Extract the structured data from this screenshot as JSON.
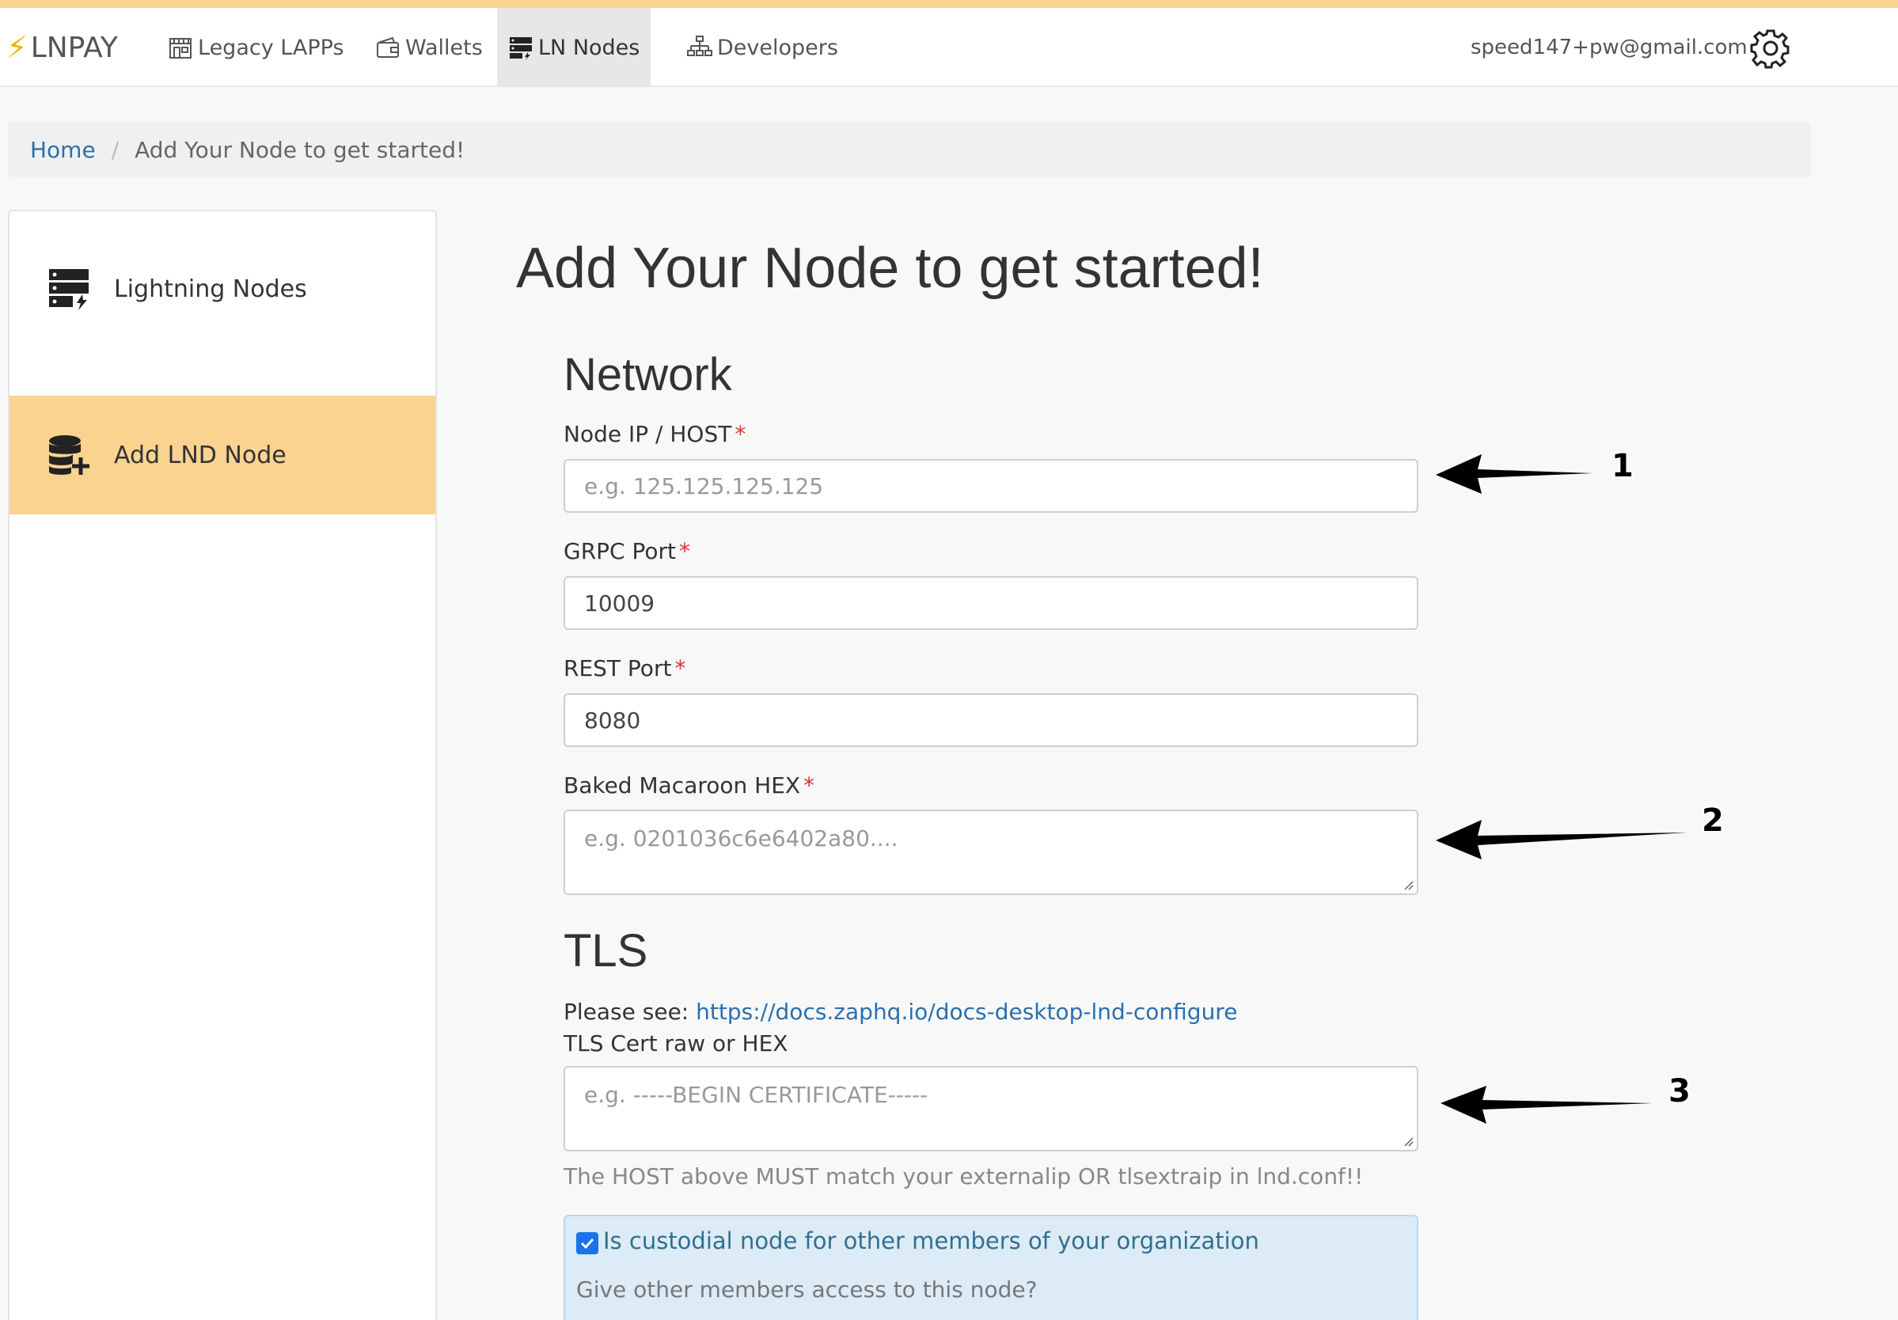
{
  "nav": {
    "brand": "LNPAY",
    "items": [
      {
        "label": "Legacy LAPPs",
        "icon": "store-icon"
      },
      {
        "label": "Wallets",
        "icon": "wallet-icon"
      },
      {
        "label": "LN Nodes",
        "icon": "server-icon"
      },
      {
        "label": "Developers",
        "icon": "sitemap-icon"
      }
    ],
    "active": "LN Nodes",
    "email": "speed147+pw@gmail.com"
  },
  "breadcrumb": {
    "home": "Home",
    "current": "Add Your Node to get started!"
  },
  "sidebar": {
    "items": [
      {
        "label": "Lightning Nodes",
        "icon": "lightning-server-icon"
      },
      {
        "label": "Add LND Node",
        "icon": "database-plus-icon"
      }
    ],
    "active": "Add LND Node"
  },
  "main": {
    "title": "Add Your Node to get started!",
    "network_heading": "Network",
    "host": {
      "label": "Node IP / HOST",
      "placeholder": "e.g. 125.125.125.125"
    },
    "grpc": {
      "label": "GRPC Port",
      "value": "10009"
    },
    "rest": {
      "label": "REST Port",
      "value": "8080"
    },
    "macaroon": {
      "label": "Baked Macaroon HEX",
      "placeholder": "e.g. 0201036c6e6402a80...."
    },
    "tls_heading": "TLS",
    "please_see": "Please see:",
    "docs_link": "https://docs.zaphq.io/docs-desktop-lnd-configure",
    "tls": {
      "label": "TLS Cert raw or HEX",
      "placeholder": "e.g. -----BEGIN CERTIFICATE-----"
    },
    "tls_note": "The HOST above MUST match your externalip OR tlsextraip in lnd.conf!!",
    "custodial": {
      "checked": true,
      "label": "Is custodial node for other members of your organization",
      "sub": "Give other members access to this node?"
    },
    "required_marker": "*"
  },
  "annotations": [
    "1",
    "2",
    "3"
  ],
  "colors": {
    "accent": "#fad390",
    "link": "#2a6fb0",
    "required": "#d9342b",
    "info_bg": "#dcebf6"
  }
}
